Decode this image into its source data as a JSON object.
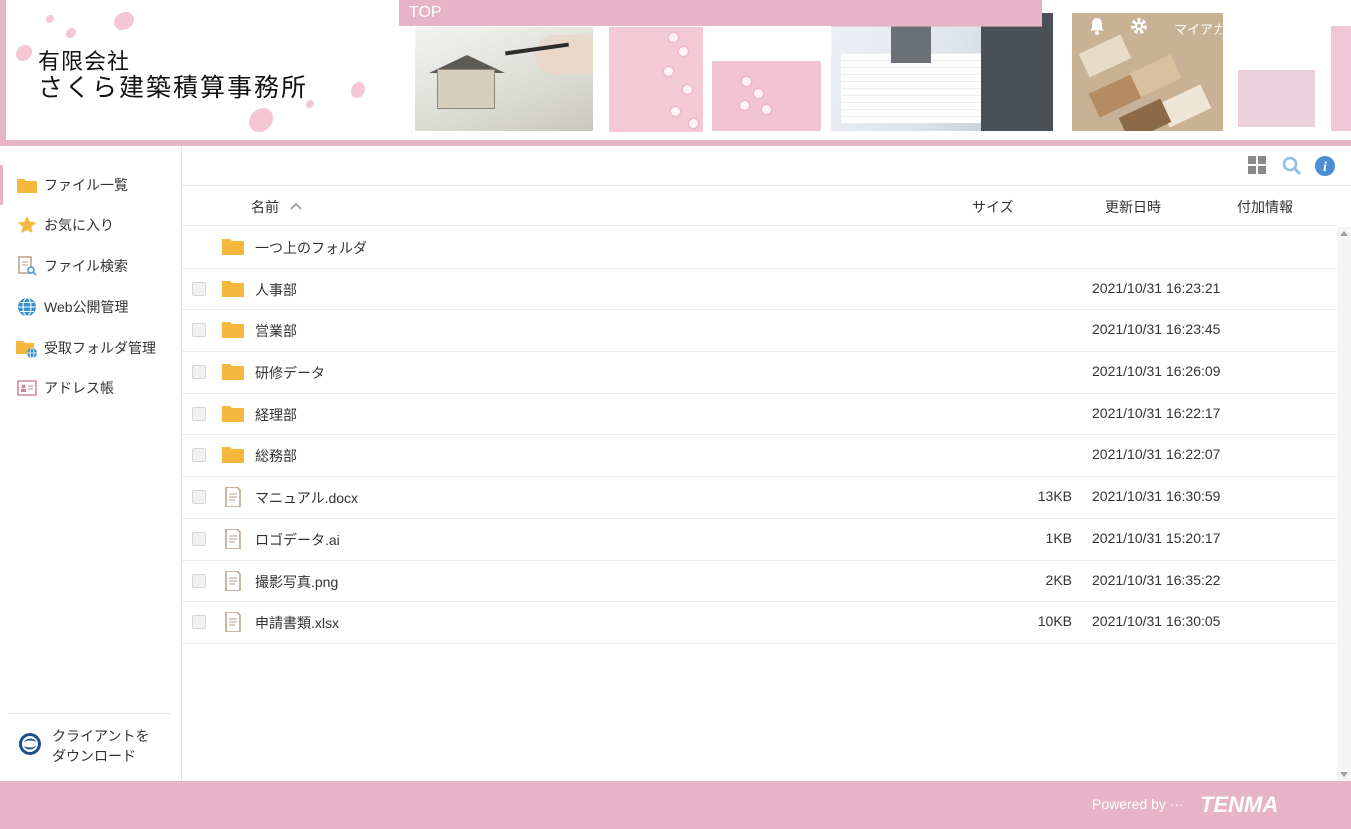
{
  "header": {
    "company_line1": "有限会社",
    "company_line2": "さくら建築積算事務所",
    "top_tab": "TOP",
    "my_account": "マイアカウント",
    "bell_icon": "bell-icon",
    "gear_icon": "gear-icon",
    "accent_color": "#e6b3c7"
  },
  "sidebar": {
    "items": [
      {
        "label": "ファイル一覧",
        "icon": "folder-icon"
      },
      {
        "label": "お気に入り",
        "icon": "star-icon"
      },
      {
        "label": "ファイル検索",
        "icon": "file-search-icon"
      },
      {
        "label": "Web公開管理",
        "icon": "globe-icon"
      },
      {
        "label": "受取フォルダ管理",
        "icon": "folder-globe-icon"
      },
      {
        "label": "アドレス帳",
        "icon": "address-card-icon"
      }
    ],
    "client_download_line1": "クライアントを",
    "client_download_line2": "ダウンロード"
  },
  "table": {
    "columns": {
      "name": "名前",
      "size": "サイズ",
      "date": "更新日時",
      "extra": "付加情報"
    },
    "parent_folder": "一つ上のフォルダ",
    "rows": [
      {
        "name": "人事部",
        "type": "folder",
        "size": "",
        "date": "2021/10/31 16:23:21"
      },
      {
        "name": "営業部",
        "type": "folder",
        "size": "",
        "date": "2021/10/31 16:23:45"
      },
      {
        "name": "研修データ",
        "type": "folder",
        "size": "",
        "date": "2021/10/31 16:26:09"
      },
      {
        "name": "経理部",
        "type": "folder",
        "size": "",
        "date": "2021/10/31 16:22:17"
      },
      {
        "name": "総務部",
        "type": "folder",
        "size": "",
        "date": "2021/10/31 16:22:07"
      },
      {
        "name": "マニュアル.docx",
        "type": "file",
        "size": "13KB",
        "date": "2021/10/31 16:30:59"
      },
      {
        "name": "ロゴデータ.ai",
        "type": "file",
        "size": "1KB",
        "date": "2021/10/31 15:20:17"
      },
      {
        "name": "撮影写真.png",
        "type": "file",
        "size": "2KB",
        "date": "2021/10/31 16:35:22"
      },
      {
        "name": "申請書類.xlsx",
        "type": "file",
        "size": "10KB",
        "date": "2021/10/31 16:30:05"
      }
    ]
  },
  "footer": {
    "powered_by": "Powered by ···",
    "brand": "TENMA"
  }
}
